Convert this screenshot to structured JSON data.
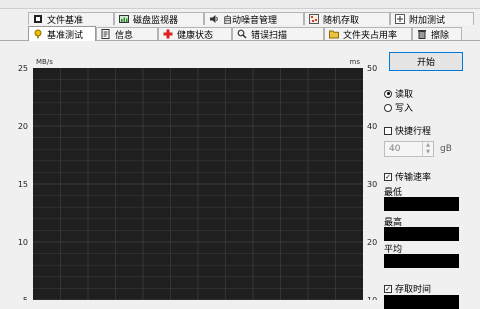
{
  "tabs_row1": [
    "文件基准",
    "磁盘监视器",
    "自动噪音管理",
    "随机存取",
    "附加测试"
  ],
  "tabs_row2": [
    "基准测试",
    "信息",
    "健康状态",
    "错误扫描",
    "文件夹占用率",
    "擦除"
  ],
  "chart_data": {
    "type": "line",
    "y_left_unit": "MB/s",
    "y_right_unit": "ms",
    "y_left_ticks": [
      "25",
      "20",
      "15",
      "10",
      "5"
    ],
    "y_right_ticks": [
      "50",
      "40",
      "30",
      "20",
      "10"
    ],
    "ylim_left": [
      0,
      25
    ],
    "ylim_right": [
      0,
      50
    ],
    "grid": true,
    "series": []
  },
  "controls": {
    "start_label": "开始",
    "read_label": "读取",
    "write_label": "写入",
    "quick_label": "快捷行程",
    "quick_value": "40",
    "quick_unit": "gB",
    "transfer_label": "传输速率",
    "min_label": "最低",
    "max_label": "最高",
    "avg_label": "平均",
    "access_label": "存取时间"
  },
  "colors": {
    "plot_bg": "#1f1f1f",
    "grid": "#3a3a3a",
    "focus": "#0078d7"
  }
}
